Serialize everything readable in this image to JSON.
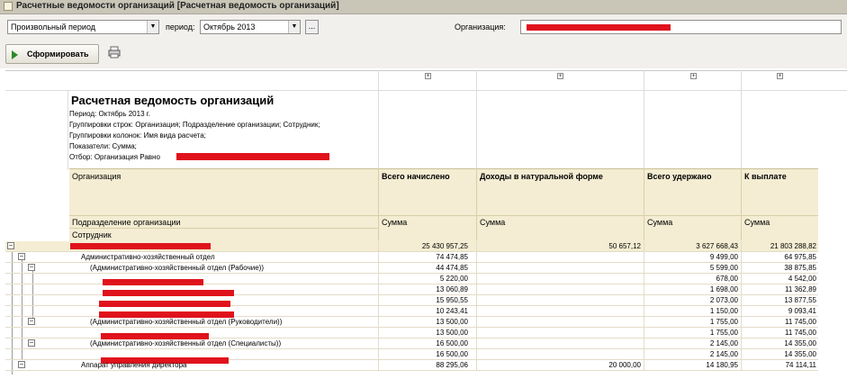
{
  "window": {
    "title": "Расчетные ведомости организаций [Расчетная ведомость организаций]"
  },
  "toolbar": {
    "period_type": "Произвольный период",
    "period_label": "период:",
    "period_value": "Октябрь 2013",
    "dots_label": "...",
    "org_label": "Организация:",
    "form_button": "Сформировать"
  },
  "report": {
    "title": "Расчетная ведомость организаций",
    "period": "Период: Октябрь 2013 г.",
    "row_groups": "Группировки строк: Организация; Подразделение организации; Сотрудник;",
    "col_groups": "Группировки колонок: Имя вида расчета;",
    "indicators": "Показатели: Сумма;",
    "filter": "Отбор: Организация Равно"
  },
  "table": {
    "headers": {
      "org": "Организация",
      "dept": "Подразделение организации",
      "employee": "Сотрудник",
      "col1": "Всего начислено",
      "col2": "Доходы в натуральной форме",
      "col3": "Всего удержано",
      "col4": "К выплате",
      "sum": "Сумма"
    },
    "rows": [
      {
        "label": "",
        "c1": "25 430 957,25",
        "c2": "50 657,12",
        "c3": "3 627 668,43",
        "c4": "21 803 288,82"
      },
      {
        "label": "Административно-хозяйственный отдел",
        "c1": "74 474,85",
        "c2": "",
        "c3": "9 499,00",
        "c4": "64 975,85"
      },
      {
        "label": "(Административно-хозяйственный отдел (Рабочие))",
        "c1": "44 474,85",
        "c2": "",
        "c3": "5 599,00",
        "c4": "38 875,85"
      },
      {
        "label": "",
        "c1": "5 220,00",
        "c2": "",
        "c3": "678,00",
        "c4": "4 542,00"
      },
      {
        "label": "",
        "c1": "13 060,89",
        "c2": "",
        "c3": "1 698,00",
        "c4": "11 362,89"
      },
      {
        "label": "",
        "c1": "15 950,55",
        "c2": "",
        "c3": "2 073,00",
        "c4": "13 877,55"
      },
      {
        "label": "",
        "c1": "10 243,41",
        "c2": "",
        "c3": "1 150,00",
        "c4": "9 093,41"
      },
      {
        "label": "(Административно-хозяйственный отдел (Руководители))",
        "c1": "13 500,00",
        "c2": "",
        "c3": "1 755,00",
        "c4": "11 745,00"
      },
      {
        "label": "",
        "c1": "13 500,00",
        "c2": "",
        "c3": "1 755,00",
        "c4": "11 745,00"
      },
      {
        "label": "(Административно-хозяйственный отдел (Специалисты))",
        "c1": "16 500,00",
        "c2": "",
        "c3": "2 145,00",
        "c4": "14 355,00"
      },
      {
        "label": "",
        "c1": "16 500,00",
        "c2": "",
        "c3": "2 145,00",
        "c4": "14 355,00"
      },
      {
        "label": "Аппарат управления директора",
        "c1": "88 295,06",
        "c2": "20 000,00",
        "c3": "14 180,95",
        "c4": "74 114,11"
      }
    ]
  }
}
